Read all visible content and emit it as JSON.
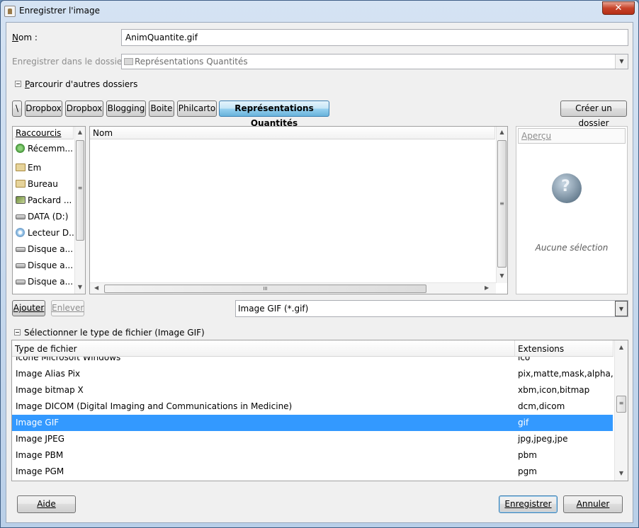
{
  "window": {
    "title": "Enregistrer l'image",
    "close_glyph": "✕"
  },
  "name_field": {
    "label_prefix": "N",
    "label_rest": "om :",
    "value": "AnimQuantite.gif"
  },
  "folder_field": {
    "label": "Enregistrer dans le dossier :",
    "value": "Représentations Quantités"
  },
  "browse": {
    "label_prefix": "P",
    "label_rest": "arcourir d'autres dossiers"
  },
  "path_bar": {
    "toggle": "\\",
    "crumbs": [
      "Dropbox",
      "Dropbox",
      "Blogging",
      "Boite",
      "Philcarto",
      "Représentations Quantités"
    ],
    "create_folder": "Créer un dossier"
  },
  "places": {
    "header": "Raccourcis",
    "items": [
      {
        "label": "Récemm...",
        "icon": "recent-icon"
      },
      {
        "label": "Em",
        "icon": "folder-icon"
      },
      {
        "label": "Bureau",
        "icon": "folder-icon"
      },
      {
        "label": "Packard ...",
        "icon": "network-drive-icon"
      },
      {
        "label": "DATA (D:)",
        "icon": "drive-icon"
      },
      {
        "label": "Lecteur D...",
        "icon": "cd-drive-icon"
      },
      {
        "label": "Disque a...",
        "icon": "drive-icon"
      },
      {
        "label": "Disque a...",
        "icon": "drive-icon"
      },
      {
        "label": "Disque a...",
        "icon": "drive-icon"
      }
    ],
    "add_button": "Ajouter",
    "remove_button": "Enlever"
  },
  "files": {
    "column_name": "Nom",
    "hscroll_grip": "III"
  },
  "preview": {
    "label": "Aperçu",
    "empty_text": "Aucune sélection"
  },
  "filter": {
    "value": "Image GIF (*.gif)"
  },
  "file_type": {
    "toggle_label": "Sélectionner le type de fichier (Image GIF)",
    "col_type": "Type de fichier",
    "col_ext": "Extensions",
    "rows": [
      {
        "type": "Icône Microsoft Windows",
        "ext": "ico"
      },
      {
        "type": "Image Alias Pix",
        "ext": "pix,matte,mask,alpha,als"
      },
      {
        "type": "Image bitmap X",
        "ext": "xbm,icon,bitmap"
      },
      {
        "type": "Image DICOM (Digital Imaging and Communications in Medicine)",
        "ext": "dcm,dicom"
      },
      {
        "type": "Image GIF",
        "ext": "gif"
      },
      {
        "type": "Image JPEG",
        "ext": "jpg,jpeg,jpe"
      },
      {
        "type": "Image PBM",
        "ext": "pbm"
      },
      {
        "type": "Image PGM",
        "ext": "pgm"
      }
    ],
    "selected_index": 4
  },
  "footer": {
    "help": "Aide",
    "save": "Enregistrer",
    "cancel": "Annuler"
  },
  "colors": {
    "selection": "#3399ff",
    "active_crumb": "#98d1ef"
  }
}
